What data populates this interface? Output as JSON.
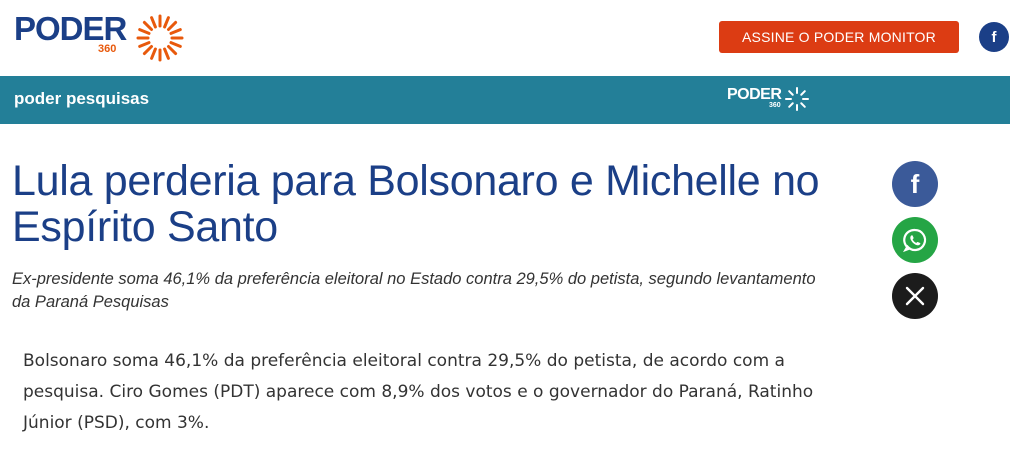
{
  "header": {
    "logo_text": "PODER",
    "logo_sub": "360",
    "cta_label": "ASSINE O PODER MONITOR",
    "fb_label": "f"
  },
  "section": {
    "title": "poder pesquisas",
    "logo_text": "PODER",
    "logo_sub": "360"
  },
  "article": {
    "headline": "Lula perderia para Bolsonaro e Michelle no Espírito Santo",
    "subhead": "Ex-presidente soma 46,1% da preferência eleitoral no Estado contra 29,5% do petista, segundo levantamento da Paraná Pesquisas",
    "body": "Bolsonaro soma 46,1% da preferência eleitoral contra 29,5% do petista, de acordo com a pesquisa. Ciro Gomes (PDT) aparece com 8,9% dos votos e o governador do Paraná, Ratinho Júnior (PSD), com 3%."
  },
  "share": {
    "facebook_label": "f",
    "whatsapp_icon": "whatsapp-icon",
    "x_icon": "x-icon"
  },
  "colors": {
    "brand_blue": "#1b3f87",
    "brand_orange": "#e8590c",
    "cta_red": "#dc3c13",
    "section_teal": "#237f98"
  }
}
